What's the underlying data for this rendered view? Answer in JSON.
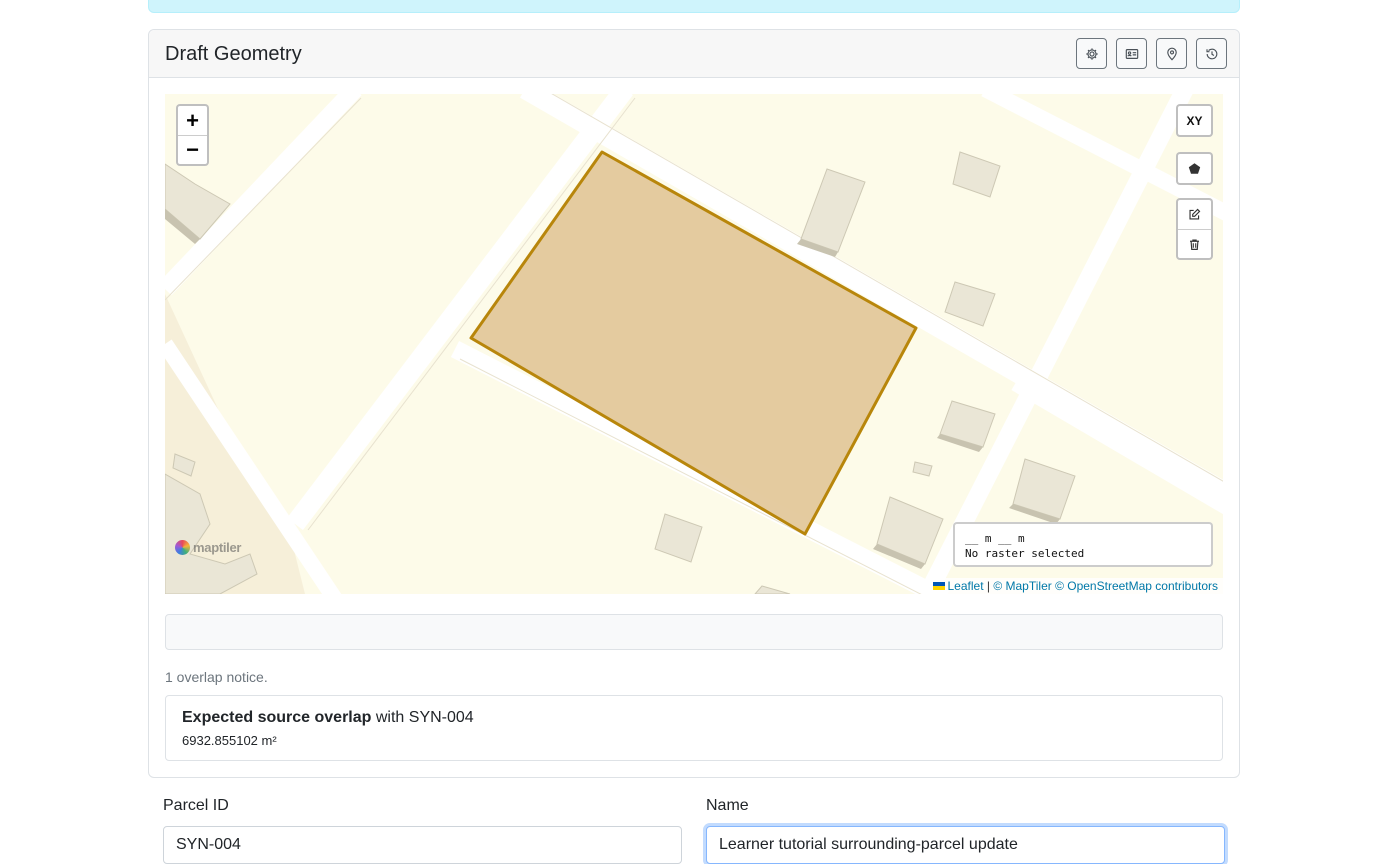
{
  "card": {
    "title": "Draft Geometry",
    "header_buttons": [
      {
        "name": "settings-button",
        "icon": "gear-icon"
      },
      {
        "name": "id-card-button",
        "icon": "id-card-icon"
      },
      {
        "name": "location-button",
        "icon": "map-pin-icon"
      },
      {
        "name": "history-button",
        "icon": "history-icon"
      }
    ]
  },
  "map": {
    "zoom_in_label": "+",
    "zoom_out_label": "−",
    "xy_label": "XY",
    "info_line1": "__ m __ m",
    "info_line2": "No raster selected",
    "attribution": {
      "leaflet": "Leaflet",
      "separator": " | ",
      "maptiler": "© MapTiler",
      "osm": "© OpenStreetMap contributors"
    },
    "logo_text": "maptiler",
    "polygon_fill": "#e3c89b",
    "polygon_stroke": "#b8860b"
  },
  "overlap": {
    "count_text": "1 overlap notice.",
    "title_bold": "Expected source overlap",
    "title_rest": " with SYN-004",
    "area": "6932.855102 m²"
  },
  "form": {
    "parcel_id_label": "Parcel ID",
    "parcel_id_value": "SYN-004",
    "name_label": "Name",
    "name_value": "Learner tutorial surrounding-parcel update"
  }
}
